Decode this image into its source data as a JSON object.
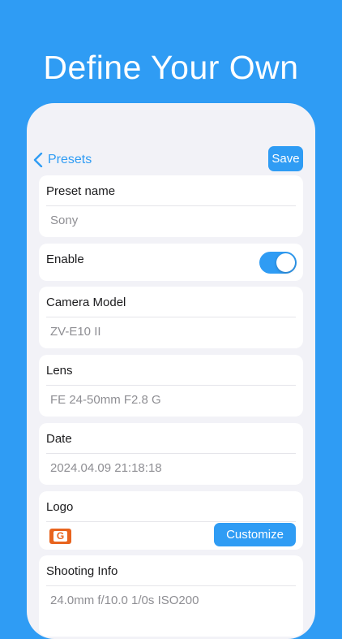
{
  "headline": "Define Your Own",
  "navbar": {
    "back_label": "Presets",
    "save_label": "Save"
  },
  "preset": {
    "label": "Preset name",
    "value": "Sony"
  },
  "enable": {
    "label": "Enable",
    "on": true
  },
  "camera": {
    "label": "Camera Model",
    "value": "ZV-E10 II"
  },
  "lens": {
    "label": "Lens",
    "value": "FE 24-50mm F2.8 G"
  },
  "date": {
    "label": "Date",
    "value": "2024.04.09 21:18:18"
  },
  "logo": {
    "label": "Logo",
    "badge_letter": "G",
    "badge_color": "#e8641e",
    "customize_label": "Customize"
  },
  "shooting": {
    "label": "Shooting Info",
    "value": "24.0mm f/10.0 1/0s ISO200"
  },
  "colors": {
    "accent": "#2f9cf4",
    "background": "#2f9cf4",
    "panel": "#f2f2f7"
  }
}
